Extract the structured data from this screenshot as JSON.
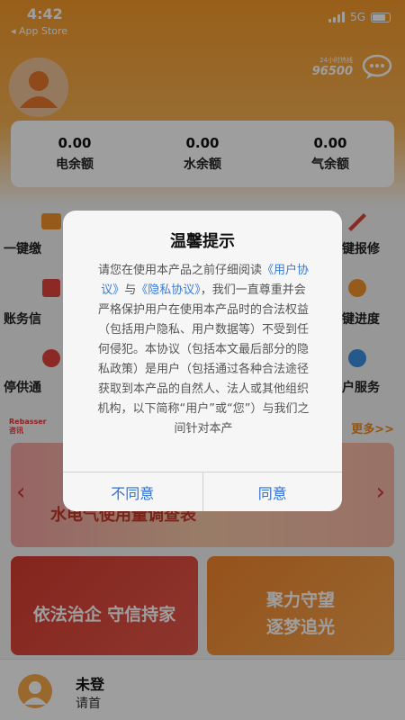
{
  "status_bar": {
    "time": "4:42",
    "back_label": "◂ App Store",
    "network": "5G"
  },
  "header": {
    "hotline_number": "96500",
    "hotline_sub": "24小时热线"
  },
  "balances": [
    {
      "value": "0.00",
      "label": "电余额"
    },
    {
      "value": "0.00",
      "label": "水余额"
    },
    {
      "value": "0.00",
      "label": "气余额"
    }
  ],
  "services": {
    "left": [
      "一键缴",
      "账务信",
      "停供通"
    ],
    "right": [
      "键报修",
      "键进度",
      "户服务"
    ]
  },
  "news": {
    "logo_line1": "Rebasser",
    "logo_line2": "咨讯",
    "more": "更多>>"
  },
  "banner": {
    "text": "水电气使用量调查表"
  },
  "cards": {
    "left": "依法治企  守信持家",
    "right_line1": "聚力守望",
    "right_line2": "逐梦追光"
  },
  "login": {
    "title": "未登",
    "subtitle": "请首"
  },
  "dialog": {
    "title": "温馨提示",
    "body_1": "请您在使用本产品之前仔细阅读",
    "link_1": "《用户协议》",
    "body_2": "与",
    "link_2": "《隐私协议》",
    "body_3": "，我们一直尊重并会严格保护用户在使用本产品时的合法权益（包括用户隐私、用户数据等）不受到任何侵犯。本协议（包括本文最后部分的隐私政策）是用户（包括通过各种合法途径获取到本产品的自然人、法人或其他组织机构，以下简称“用户”或“您”）与我们之间针对本产",
    "disagree": "不同意",
    "agree": "同意"
  }
}
